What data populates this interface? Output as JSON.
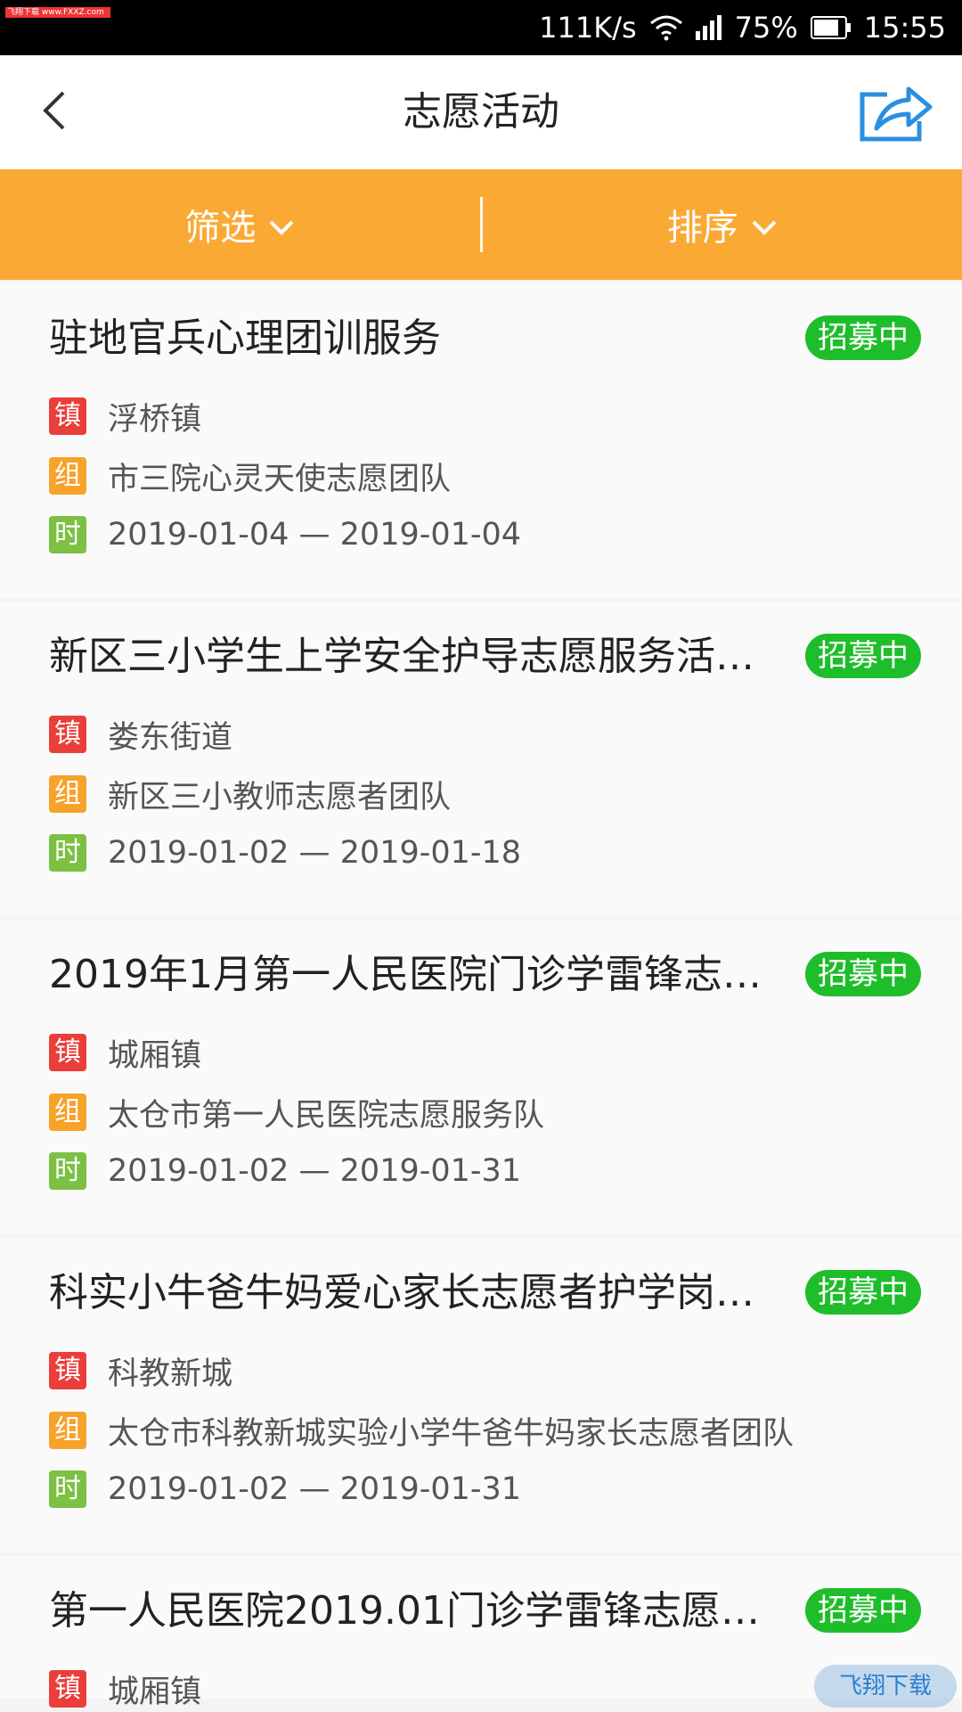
{
  "status_bar": {
    "watermark": "飞翔下载 www.FXXZ.com",
    "net_speed": "111K/s",
    "battery": "75%",
    "time": "15:55"
  },
  "header": {
    "title": "志愿活动",
    "back_icon": "back-arrow-icon",
    "share_icon": "share-icon"
  },
  "filters": {
    "filter_label": "筛选",
    "sort_label": "排序",
    "accent": "#fba935"
  },
  "tags": {
    "town": "镇",
    "group": "组",
    "time": "时",
    "town_color": "#ea3e3a",
    "group_color": "#f7a22a",
    "time_color": "#7cc044"
  },
  "badge_color": "#1ebd2a",
  "activities": [
    {
      "title": "驻地官兵心理团训服务",
      "status": "招募中",
      "town": "浮桥镇",
      "group": "市三院心灵天使志愿团队",
      "time": "2019-01-04 — 2019-01-04"
    },
    {
      "title": "新区三小学生上学安全护导志愿服务活…",
      "status": "招募中",
      "town": "娄东街道",
      "group": "新区三小教师志愿者团队",
      "time": "2019-01-02 — 2019-01-18"
    },
    {
      "title": "2019年1月第一人民医院门诊学雷锋志…",
      "status": "招募中",
      "town": "城厢镇",
      "group": "太仓市第一人民医院志愿服务队",
      "time": "2019-01-02 — 2019-01-31"
    },
    {
      "title": "科实小牛爸牛妈爱心家长志愿者护学岗…",
      "status": "招募中",
      "town": "科教新城",
      "group": "太仓市科教新城实验小学牛爸牛妈家长志愿者团队",
      "time": "2019-01-02 — 2019-01-31"
    },
    {
      "title": "第一人民医院2019.01门诊学雷锋志愿…",
      "status": "招募中",
      "town": "城厢镇"
    }
  ],
  "watermark_bottom": "飞翔下载"
}
